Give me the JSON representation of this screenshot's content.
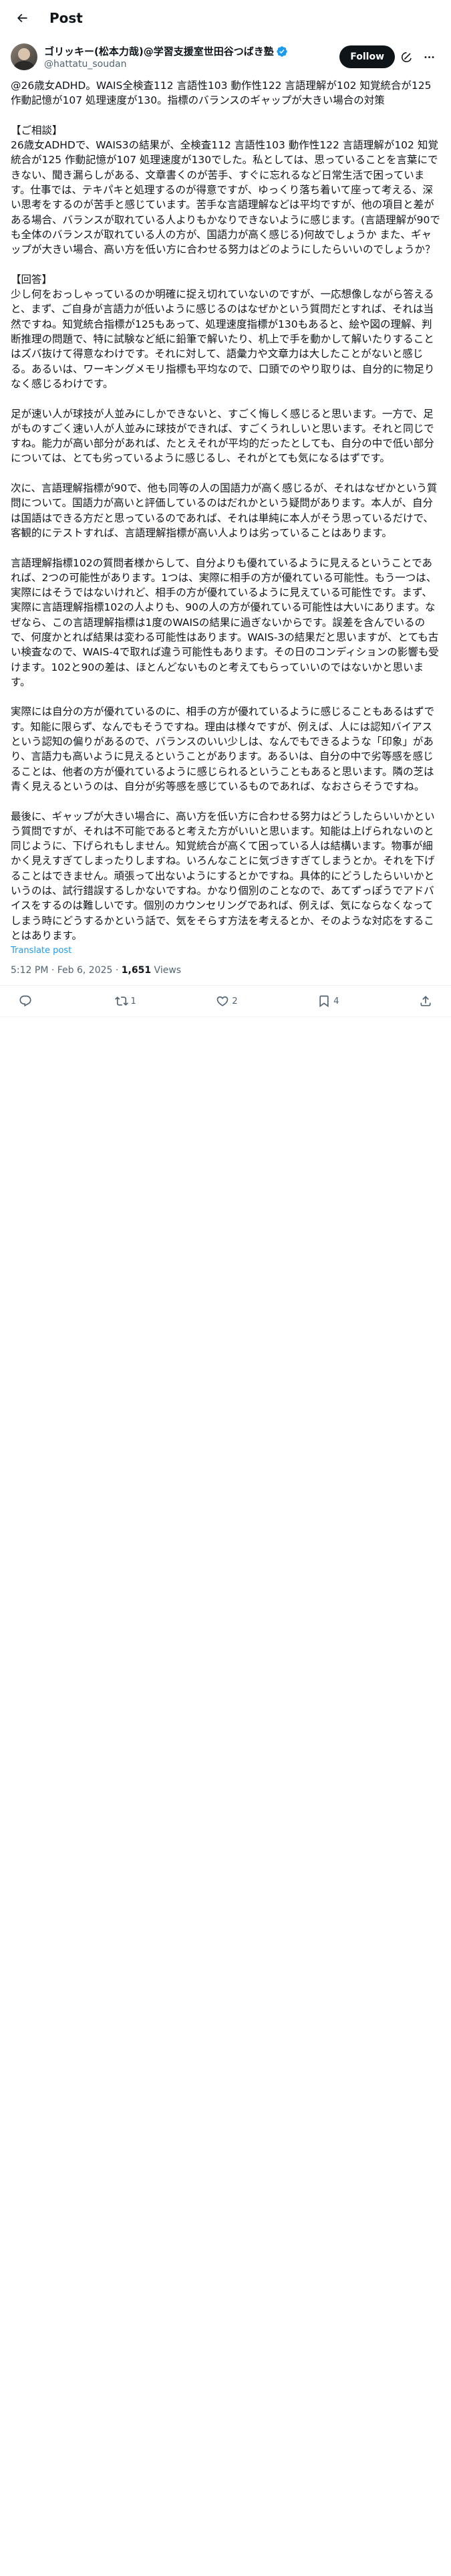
{
  "header": {
    "title": "Post"
  },
  "author": {
    "name": "ゴリッキー(松本力哉)@学習支援室世田谷つばき塾",
    "handle": "@hattatu_soudan",
    "follow_label": "Follow"
  },
  "post": {
    "body": "@26歳女ADHD。WAIS全検査112 言語性103 動作性122 言語理解が102 知覚統合が125 作動記憶が107 処理速度が130。指標のバランスのギャップが大きい場合の対策\n\n【ご相談】\n26歳女ADHDで、WAIS3の結果が、全検査112 言語性103 動作性122 言語理解が102 知覚統合が125 作動記憶が107 処理速度が130でした。私としては、思っていることを言葉にできない、聞き漏らしがある、文章書くのが苦手、すぐに忘れるなど日常生活で困っています。仕事では、テキパキと処理するのが得意ですが、ゆっくり落ち着いて座って考える、深い思考をするのが苦手と感じています。苦手な言語理解などは平均ですが、他の項目と差がある場合、バランスが取れている人よりもかなりできないように感じます。(言語理解が90でも全体のバランスが取れている人の方が、国語力が高く感じる)何故でしょうか また、ギャップが大きい場合、高い方を低い方に合わせる努力はどのようにしたらいいのでしょうか？\n\n【回答】\n少し何をおっしゃっているのか明確に捉え切れていないのですが、一応想像しながら答えると、まず、ご自身が言語力が低いように感じるのはなぜかという質問だとすれば、それは当然ですね。知覚統合指標が125もあって、処理速度指標が130もあると、絵や図の理解、判断推理の問題で、特に試験など紙に鉛筆で解いたり、机上で手を動かして解いたりすることはズバ抜けて得意なわけです。それに対して、語彙力や文章力は大したことがないと感じる。あるいは、ワーキングメモリ指標も平均なので、口頭でのやり取りは、自分的に物足りなく感じるわけです。\n\n足が速い人が球技が人並みにしかできないと、すごく悔しく感じると思います。一方で、足がものすごく速い人が人並みに球技ができれば、すごくうれしいと思います。それと同じですね。能力が高い部分があれば、たとえそれが平均的だったとしても、自分の中で低い部分については、とても劣っているように感じるし、それがとても気になるはずです。\n\n次に、言語理解指標が90で、他も同等の人の国語力が高く感じるが、それはなぜかという質問について。国語力が高いと評価しているのはだれかという疑問があります。本人が、自分は国語はできる方だと思っているのであれば、それは単純に本人がそう思っているだけで、客観的にテストすれば、言語理解指標が高い人よりは劣っていることはあります。\n\n言語理解指標102の質問者様からして、自分よりも優れているように見えるということであれば、2つの可能性があります。1つは、実際に相手の方が優れている可能性。もう一つは、実際にはそうではないけれど、相手の方が優れているように見えている可能性です。まず、実際に言語理解指標102の人よりも、90の人の方が優れている可能性は大いにあります。なぜなら、この言語理解指標は1度のWAISの結果に過ぎないからです。誤差を含んでいるので、何度かとれば結果は変わる可能性はあります。WAIS-3の結果だと思いますが、とても古い検査なので、WAIS-4で取れば違う可能性もあります。その日のコンディションの影響も受けます。102と90の差は、ほとんどないものと考えてもらっていいのではないかと思います。\n\n実際には自分の方が優れているのに、相手の方が優れているように感じることもあるはずです。知能に限らず、なんでもそうですね。理由は様々ですが、例えば、人には認知バイアスという認知の偏りがあるので、バランスのいい少しは、なんでもできるような「印象」があり、言語力も高いように見えるということがあります。あるいは、自分の中で劣等感を感じることは、他者の方が優れているように感じられるということもあると思います。隣の芝は青く見えるというのは、自分が劣等感を感じているものであれば、なおさらそうですね。\n\n最後に、ギャップが大きい場合に、高い方を低い方に合わせる努力はどうしたらいいかという質問ですが、それは不可能であると考えた方がいいと思います。知能は上げられないのと同じように、下げられもしません。知覚統合が高くて困っている人は結構います。物事が細かく見えすぎてしまったりしますね。いろんなことに気づきすぎてしまうとか。それを下げることはできません。頑張って出ないようにするとかですね。具体的にどうしたらいいかというのは、試行錯誤するしかないですね。かなり個別のことなので、あてずっぽうでアドバイスをするのは難しいです。個別のカウンセリングであれば、例えば、気にならなくなってしまう時にどうするかという話で、気をそらす方法を考えるとか、そのような対応をすることはあります。",
    "translate_label": "Translate post",
    "time": "5:12 PM · Feb 6, 2025 · ",
    "views_count": "1,651",
    "views_label": " Views"
  },
  "actions": {
    "reply_count": "",
    "repost_count": "1",
    "like_count": "2",
    "bookmark_count": "4"
  },
  "icons": {
    "back": "arrow-left-icon",
    "verified": "verified-badge-icon",
    "grok": "grok-icon",
    "more": "more-icon",
    "reply": "reply-icon",
    "repost": "repost-icon",
    "like": "heart-icon",
    "bookmark": "bookmark-icon",
    "share": "share-icon"
  },
  "colors": {
    "accent": "#1d9bf0",
    "text": "#0f1419",
    "secondary": "#536471"
  }
}
